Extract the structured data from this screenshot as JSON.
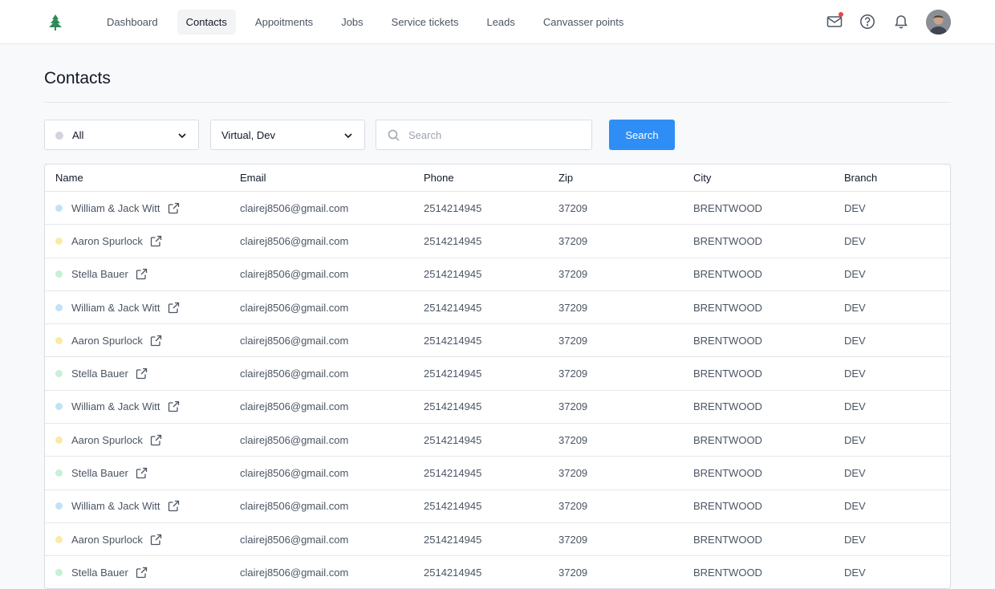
{
  "nav": {
    "items": [
      {
        "label": "Dashboard"
      },
      {
        "label": "Contacts"
      },
      {
        "label": "Appoitments"
      },
      {
        "label": "Jobs"
      },
      {
        "label": "Service tickets"
      },
      {
        "label": "Leads"
      },
      {
        "label": "Canvasser points"
      }
    ],
    "active_index": 1
  },
  "icons": {
    "logo": "pine-tree-icon",
    "mail": "mail-icon",
    "help": "help-circle-icon",
    "bell": "bell-icon"
  },
  "colors": {
    "accent": "#2f8ef5",
    "logo": "#2e8b57",
    "notification": "#ef4444",
    "status_blue": "#bfe3f7",
    "status_yellow": "#fbe9a6",
    "status_green": "#c9efd8"
  },
  "page": {
    "title": "Contacts"
  },
  "filters": {
    "status": {
      "value": "All"
    },
    "branch": {
      "value": "Virtual, Dev"
    },
    "search": {
      "placeholder": "Search",
      "value": ""
    },
    "search_button": "Search"
  },
  "table": {
    "columns": [
      "Name",
      "Email",
      "Phone",
      "Zip",
      "City",
      "Branch"
    ],
    "rows": [
      {
        "status": "blue",
        "name": "William & Jack Witt",
        "email": "clairej8506@gmail.com",
        "phone": "2514214945",
        "zip": "37209",
        "city": "BRENTWOOD",
        "branch": "DEV"
      },
      {
        "status": "yellow",
        "name": "Aaron Spurlock",
        "email": "clairej8506@gmail.com",
        "phone": "2514214945",
        "zip": "37209",
        "city": "BRENTWOOD",
        "branch": "DEV"
      },
      {
        "status": "green",
        "name": "Stella Bauer",
        "email": "clairej8506@gmail.com",
        "phone": "2514214945",
        "zip": "37209",
        "city": "BRENTWOOD",
        "branch": "DEV"
      },
      {
        "status": "blue",
        "name": "William & Jack Witt",
        "email": "clairej8506@gmail.com",
        "phone": "2514214945",
        "zip": "37209",
        "city": "BRENTWOOD",
        "branch": "DEV"
      },
      {
        "status": "yellow",
        "name": "Aaron Spurlock",
        "email": "clairej8506@gmail.com",
        "phone": "2514214945",
        "zip": "37209",
        "city": "BRENTWOOD",
        "branch": "DEV"
      },
      {
        "status": "green",
        "name": "Stella Bauer",
        "email": "clairej8506@gmail.com",
        "phone": "2514214945",
        "zip": "37209",
        "city": "BRENTWOOD",
        "branch": "DEV"
      },
      {
        "status": "blue",
        "name": "William & Jack Witt",
        "email": "clairej8506@gmail.com",
        "phone": "2514214945",
        "zip": "37209",
        "city": "BRENTWOOD",
        "branch": "DEV"
      },
      {
        "status": "yellow",
        "name": "Aaron Spurlock",
        "email": "clairej8506@gmail.com",
        "phone": "2514214945",
        "zip": "37209",
        "city": "BRENTWOOD",
        "branch": "DEV"
      },
      {
        "status": "green",
        "name": "Stella Bauer",
        "email": "clairej8506@gmail.com",
        "phone": "2514214945",
        "zip": "37209",
        "city": "BRENTWOOD",
        "branch": "DEV"
      },
      {
        "status": "blue",
        "name": "William & Jack Witt",
        "email": "clairej8506@gmail.com",
        "phone": "2514214945",
        "zip": "37209",
        "city": "BRENTWOOD",
        "branch": "DEV"
      },
      {
        "status": "yellow",
        "name": "Aaron Spurlock",
        "email": "clairej8506@gmail.com",
        "phone": "2514214945",
        "zip": "37209",
        "city": "BRENTWOOD",
        "branch": "DEV"
      },
      {
        "status": "green",
        "name": "Stella Bauer",
        "email": "clairej8506@gmail.com",
        "phone": "2514214945",
        "zip": "37209",
        "city": "BRENTWOOD",
        "branch": "DEV"
      }
    ]
  }
}
